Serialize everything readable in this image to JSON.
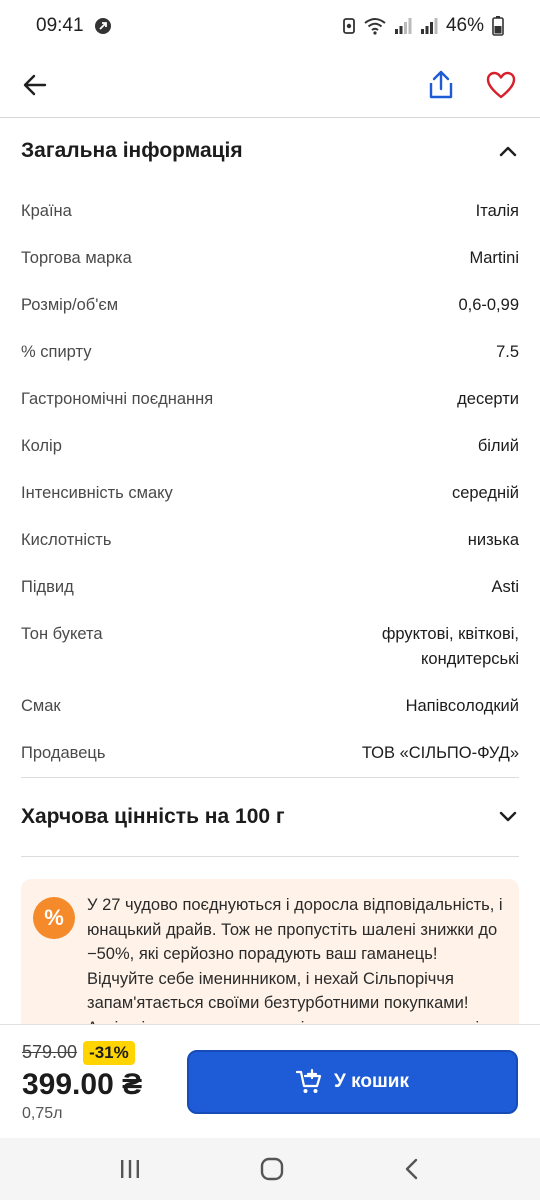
{
  "status_bar": {
    "time": "09:41",
    "battery": "46%"
  },
  "header": {
    "back_icon": "arrow-left-icon",
    "share_icon": "share-icon",
    "favorite_icon": "heart-icon"
  },
  "general_info": {
    "title": "Загальна інформація",
    "specs": [
      {
        "label": "Країна",
        "value": "Італія"
      },
      {
        "label": "Торгова марка",
        "value": "Martini"
      },
      {
        "label": "Розмір/об'єм",
        "value": "0,6-0,99"
      },
      {
        "label": "% спирту",
        "value": "7.5"
      },
      {
        "label": "Гастрономічні поєднання",
        "value": "десерти"
      },
      {
        "label": "Колір",
        "value": "білий"
      },
      {
        "label": "Інтенсивність смаку",
        "value": "середній"
      },
      {
        "label": "Кислотність",
        "value": "низька"
      },
      {
        "label": "Підвид",
        "value": "Asti"
      },
      {
        "label": "Тон букета",
        "value": "фруктові, квіткові, кондитерські"
      },
      {
        "label": "Смак",
        "value": "Напівсолодкий"
      },
      {
        "label": "Продавець",
        "value": "ТОВ «СІЛЬПО-ФУД»"
      }
    ]
  },
  "nutrition": {
    "title": "Харчова цінність на 100 г"
  },
  "promo": {
    "badge": "%",
    "text": "У 27 чудово поєднуються і доросла відповідальність, і юнацький драйв. Тож не пропустіть шалені знижки до −50%, які серйозно порадують ваш гаманець! Відчуйте себе іменинником, і нехай Сільпоріччя запам'ятається своїми безтурботними покупками! Акція діє за умови наявності товару в супермаркеті."
  },
  "purchase": {
    "old_price": "579.00",
    "discount": "-31%",
    "new_price": "399.00 ₴",
    "volume": "0,75л",
    "cart_label": "У кошик"
  },
  "colors": {
    "accent": "#1e5bd7",
    "favorite": "#d6202c",
    "discount_bg": "#ffd400",
    "promo_badge": "#f58a2a",
    "promo_bg": "#fff3e9"
  }
}
